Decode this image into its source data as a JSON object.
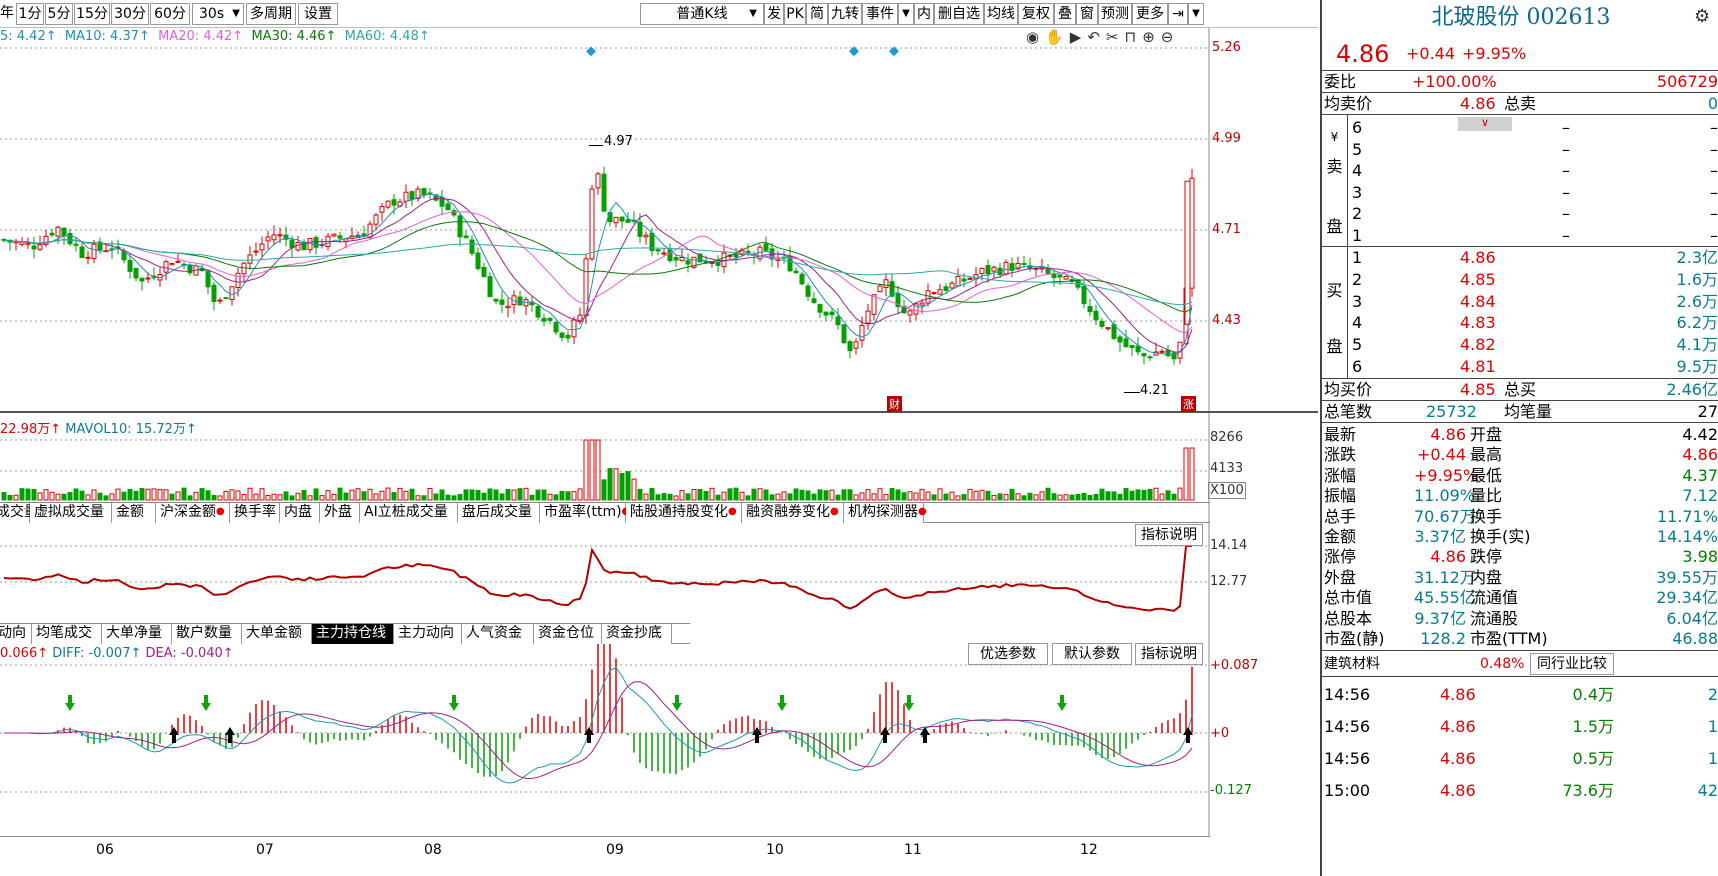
{
  "toolbar": {
    "left": [
      "年",
      "1分",
      "5分",
      "15分",
      "30分",
      "60分",
      "30s",
      "多周期",
      "设置"
    ],
    "kline_type": "普通K线",
    "right": [
      "发",
      "PK",
      "简",
      "九转",
      "事件",
      "内",
      "删自选",
      "均线",
      "复权",
      "叠",
      "窗",
      "预测",
      "更多"
    ]
  },
  "ma_line": {
    "ma5": "5: 4.42↑",
    "ma10": "MA10: 4.37↑",
    "ma20": "MA20: 4.42↑",
    "ma30": "MA30: 4.46↑",
    "ma60": "MA60: 4.48↑"
  },
  "colors": {
    "up": "#e00000",
    "down": "#00a000",
    "ma5": "#1a8fc0",
    "ma10": "#a0208c",
    "ma20": "#e060e0",
    "ma30": "#0a7a0a",
    "ma60": "#2aa8a8"
  },
  "price_axis": [
    "5.26",
    "4.99",
    "4.71",
    "4.43"
  ],
  "annotations": {
    "high": "4.97",
    "low": "4.21",
    "badge_cai": "财",
    "badge_zhang": "涨"
  },
  "volume": {
    "info1": "22.98万↑",
    "info2": "MAVOL10: 15.72万↑",
    "axis": [
      "8266",
      "4133"
    ],
    "unit": "X100"
  },
  "tabs1": [
    {
      "label": "成交量",
      "dot": false
    },
    {
      "label": "虚拟成交量",
      "dot": false
    },
    {
      "label": "金额",
      "dot": false
    },
    {
      "label": "沪深金额",
      "dot": true
    },
    {
      "label": "换手率",
      "dot": false
    },
    {
      "label": "内盘",
      "dot": false
    },
    {
      "label": "外盘",
      "dot": false
    },
    {
      "label": "AI立桩成交量",
      "dot": false
    },
    {
      "label": "盘后成交量",
      "dot": false
    },
    {
      "label": "市盈率(ttm)",
      "dot": true
    },
    {
      "label": "陆股通持股变化",
      "dot": true
    },
    {
      "label": "融资融券变化",
      "dot": true
    },
    {
      "label": "机构探测器",
      "dot": true
    }
  ],
  "pe_panel": {
    "explain": "指标说明",
    "axis": [
      "14.14",
      "12.77"
    ]
  },
  "tabs2": [
    "动向",
    "均笔成交",
    "大单净量",
    "散户数量",
    "大单金额",
    "主力持仓线",
    "主力动向",
    "人气资金",
    "资金仓位",
    "资金抄底"
  ],
  "tabs2_active": "主力持仓线",
  "macd": {
    "info1": "0.066↑",
    "info2": "DIFF: -0.007↑",
    "info3": "DEA: -0.040↑",
    "btn1": "优选参数",
    "btn2": "默认参数",
    "btn3": "指标说明",
    "axis": [
      "+0.087",
      "+0",
      "-0.127"
    ]
  },
  "xaxis": [
    "06",
    "07",
    "08",
    "09",
    "10",
    "11",
    "12"
  ],
  "stock": {
    "name": "北玻股份 002613",
    "price": "4.86",
    "change": "+0.44",
    "pct": "+9.95%"
  },
  "order": {
    "weibi_l": "委比",
    "weibi": "+100.00%",
    "weibi_r": "506729",
    "jmj_l": "均卖价",
    "jmj": "4.86",
    "zm_l": "总卖",
    "zm": "0",
    "sell_side": "卖盘",
    "sell": [
      {
        "n": "6",
        "p": "–"
      },
      {
        "n": "5",
        "p": "–"
      },
      {
        "n": "4",
        "p": "–"
      },
      {
        "n": "3",
        "p": "–"
      },
      {
        "n": "2",
        "p": "–"
      },
      {
        "n": "1",
        "p": "–"
      }
    ],
    "buy_side": "买盘",
    "buy": [
      {
        "n": "1",
        "p": "4.86",
        "v": "2.3亿"
      },
      {
        "n": "2",
        "p": "4.85",
        "v": "1.6万"
      },
      {
        "n": "3",
        "p": "4.84",
        "v": "2.6万"
      },
      {
        "n": "4",
        "p": "4.83",
        "v": "6.2万"
      },
      {
        "n": "5",
        "p": "4.82",
        "v": "4.1万"
      },
      {
        "n": "6",
        "p": "4.81",
        "v": "9.5万"
      }
    ],
    "jbj_l": "均买价",
    "jbj": "4.85",
    "zb_l": "总买",
    "zb": "2.46亿",
    "zbs_l": "总笔数",
    "zbs": "25732",
    "jbl_l": "均笔量",
    "jbl": "27"
  },
  "stats": [
    [
      "最新",
      "4.86",
      "开盘",
      "4.42"
    ],
    [
      "涨跌",
      "+0.44",
      "最高",
      "4.86"
    ],
    [
      "涨幅",
      "+9.95%",
      "最低",
      "4.37"
    ],
    [
      "振幅",
      "11.09%",
      "量比",
      "7.12"
    ],
    [
      "总手",
      "70.67万",
      "换手",
      "11.71%"
    ],
    [
      "金额",
      "3.37亿",
      "换手(实)",
      "14.14%"
    ],
    [
      "涨停",
      "4.86",
      "跌停",
      "3.98"
    ],
    [
      "外盘",
      "31.12万",
      "内盘",
      "39.55万"
    ],
    [
      "总市值",
      "45.55亿",
      "流通值",
      "29.34亿"
    ],
    [
      "总股本",
      "9.37亿",
      "流通股",
      "6.04亿"
    ],
    [
      "市盈(静)",
      "128.2",
      "市盈(TTM)",
      "46.88"
    ]
  ],
  "industry": {
    "name": "建筑材料",
    "pct": "0.48%",
    "btn": "同行业比较"
  },
  "ticks": [
    {
      "t": "14:56",
      "p": "4.86",
      "v": "0.4万",
      "n": "2"
    },
    {
      "t": "14:56",
      "p": "4.86",
      "v": "1.5万",
      "n": "1"
    },
    {
      "t": "14:56",
      "p": "4.86",
      "v": "0.5万",
      "n": "1"
    },
    {
      "t": "15:00",
      "p": "4.86",
      "v": "73.6万",
      "n": "42"
    }
  ],
  "chart_data": {
    "type": "candlestick",
    "price_axis": [
      4.43,
      4.71,
      4.99,
      5.26
    ],
    "labeled_high": 4.97,
    "labeled_low": 4.21,
    "last_close": 4.86,
    "ma": {
      "MA5": 4.42,
      "MA10": 4.37,
      "MA20": 4.42,
      "MA30": 4.46,
      "MA60": 4.48
    },
    "volume_axis": [
      4133,
      8266
    ],
    "macd": {
      "DIFF": -0.007,
      "DEA": -0.04,
      "axis": [
        -0.127,
        0,
        0.087
      ]
    },
    "pe_axis": [
      12.77,
      14.14
    ],
    "x_months": [
      "06",
      "07",
      "08",
      "09",
      "10",
      "11",
      "12"
    ]
  }
}
